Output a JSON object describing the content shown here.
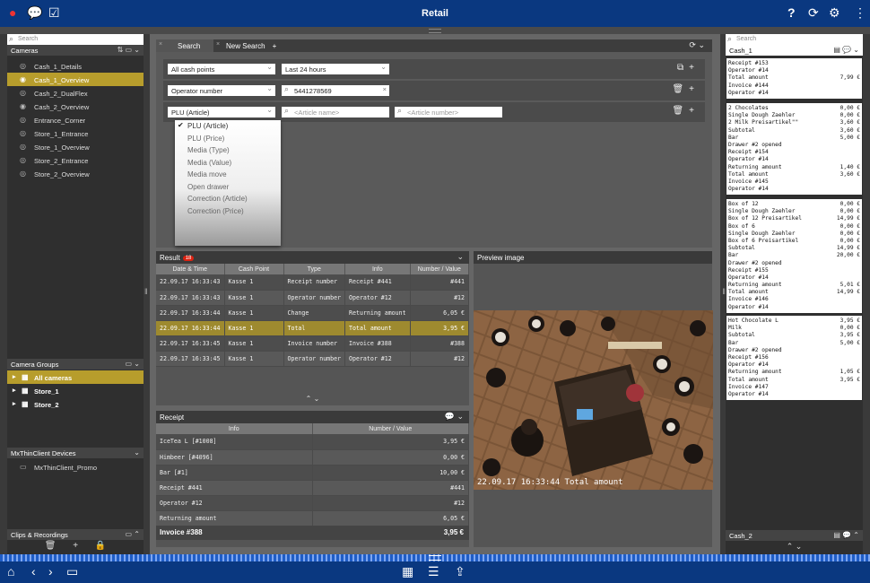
{
  "app": {
    "title": "Retail"
  },
  "left": {
    "search_placeholder": "Search",
    "cameras_title": "Cameras",
    "cameras": [
      "Cash_1_Details",
      "Cash_1_Overview",
      "Cash_2_DualFlex",
      "Cash_2_Overview",
      "Entrance_Corner",
      "Store_1_Entrance",
      "Store_1_Overview",
      "Store_2_Entrance",
      "Store_2_Overview"
    ],
    "groups_title": "Camera Groups",
    "groups": [
      "All cameras",
      "Store_1",
      "Store_2"
    ],
    "devices_title": "MxThinClient Devices",
    "devices": [
      "MxThinClient_Promo"
    ],
    "clips_title": "Clips & Recordings"
  },
  "search": {
    "tabs": [
      "Search",
      "New Search"
    ],
    "cash_points": "All cash points",
    "time_range": "Last 24 hours",
    "field_type": "Operator number",
    "field_value": "5441278569",
    "plu_type": "PLU (Article)",
    "article_name_placeholder": "<Article name>",
    "article_number_placeholder": "<Article number>",
    "dropdown": [
      "PLU (Article)",
      "PLU (Price)",
      "Media (Type)",
      "Media (Value)",
      "Media move",
      "Open drawer",
      "Correction (Article)",
      "Correction (Price)"
    ]
  },
  "result": {
    "title": "Result",
    "count": "18",
    "columns": [
      "Date & Time",
      "Cash Point",
      "Type",
      "Info",
      "Number / Value"
    ],
    "rows": [
      [
        "22.09.17 16:33:43",
        "Kasse 1",
        "Receipt number",
        "Receipt #441",
        "#441"
      ],
      [
        "22.09.17 16:33:43",
        "Kasse 1",
        "Operator number",
        "Operator #12",
        "#12"
      ],
      [
        "22.09.17 16:33:44",
        "Kasse 1",
        "Change",
        "Returning amount",
        "6,05 €"
      ],
      [
        "22.09.17 16:33:44",
        "Kasse 1",
        "Total",
        "Total amount",
        "3,95 €"
      ],
      [
        "22.09.17 16:33:45",
        "Kasse 1",
        "Invoice number",
        "Invoice #388",
        "#388"
      ],
      [
        "22.09.17 16:33:45",
        "Kasse 1",
        "Operator number",
        "Operator #12",
        "#12"
      ]
    ]
  },
  "receipt": {
    "title": "Receipt",
    "columns": [
      "Info",
      "Number / Value"
    ],
    "rows": [
      [
        "IceTea L [#1008]",
        "3,95 €"
      ],
      [
        "Himbeer [#4096]",
        "0,00 €"
      ],
      [
        "Bar [#1]",
        "10,00 €"
      ],
      [
        "Receipt #441",
        "#441"
      ],
      [
        "Operator #12",
        "#12"
      ],
      [
        "Returning amount",
        "6,05 €"
      ]
    ],
    "footer_label": "Invoice #388",
    "footer_value": "3,95 €"
  },
  "preview": {
    "title": "Preview image",
    "caption": "22.09.17 16:33:44 Total amount"
  },
  "right": {
    "search_placeholder": "Search",
    "cash1_title": "Cash_1",
    "cash2_title": "Cash_2",
    "receipts": [
      [
        [
          "Receipt #153",
          ""
        ],
        [
          "Operator #14",
          ""
        ],
        [
          "Total amount",
          "7,99 €"
        ],
        [
          "Invoice #144",
          ""
        ],
        [
          "Operator #14",
          ""
        ]
      ],
      [
        [
          "2 Chocolates",
          "0,00 €"
        ],
        [
          "Single Dough Zaehler",
          "0,00 €"
        ],
        [
          "2 Milk Preisartikel\"\"",
          "3,60 €"
        ],
        [
          "Subtotal",
          "3,60 €"
        ],
        [
          "Bar",
          "5,00 €"
        ],
        [
          "Drawer #2 opened",
          ""
        ],
        [
          "Receipt #154",
          ""
        ],
        [
          "Operator #14",
          ""
        ],
        [
          "Returning amount",
          "1,40 €"
        ],
        [
          "Total amount",
          "3,60 €"
        ],
        [
          "Invoice #145",
          ""
        ],
        [
          "Operator #14",
          ""
        ]
      ],
      [
        [
          "Box of 12",
          "0,00 €"
        ],
        [
          "Single Dough Zaehler",
          "0,00 €"
        ],
        [
          "Box of 12 Preisartikel",
          "14,99 €"
        ],
        [
          "Box of 6",
          "0,00 €"
        ],
        [
          "Single Dough Zaehler",
          "0,00 €"
        ],
        [
          "Box of 6 Preisartikel",
          "0,00 €"
        ],
        [
          "Subtotal",
          "14,99 €"
        ],
        [
          "Bar",
          "20,00 €"
        ],
        [
          "Drawer #2 opened",
          ""
        ],
        [
          "Receipt #155",
          ""
        ],
        [
          "Operator #14",
          ""
        ],
        [
          "Returning amount",
          "5,01 €"
        ],
        [
          "Total amount",
          "14,99 €"
        ],
        [
          "Invoice #146",
          ""
        ],
        [
          "Operator #14",
          ""
        ]
      ],
      [
        [
          "Hot Chocolate L",
          "3,95 €"
        ],
        [
          "Milk",
          "0,00 €"
        ],
        [
          "Subtotal",
          "3,95 €"
        ],
        [
          "Bar",
          "5,00 €"
        ],
        [
          "Drawer #2 opened",
          ""
        ],
        [
          "Receipt #156",
          ""
        ],
        [
          "Operator #14",
          ""
        ],
        [
          "Returning amount",
          "1,05 €"
        ],
        [
          "Total amount",
          "3,95 €"
        ],
        [
          "Invoice #147",
          ""
        ],
        [
          "Operator #14",
          ""
        ]
      ]
    ]
  }
}
